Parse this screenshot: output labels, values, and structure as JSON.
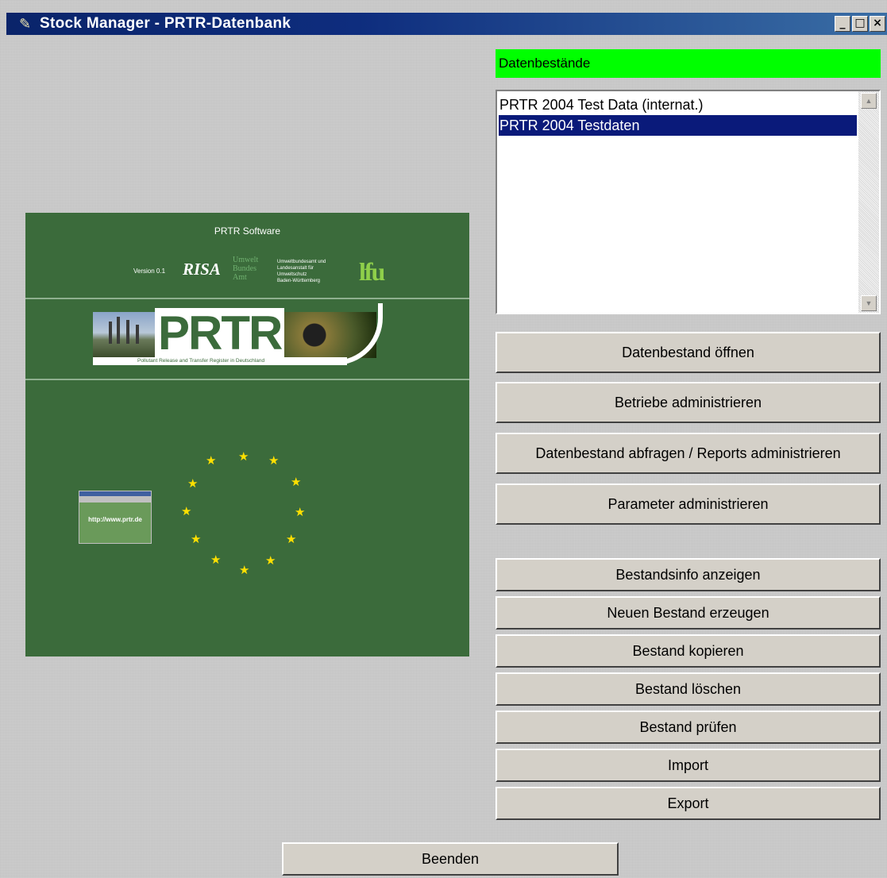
{
  "window": {
    "title": "Stock Manager - PRTR-Datenbank",
    "icon": "feather-icon",
    "controls": {
      "minimize": "_",
      "maximize": "□",
      "close": "×"
    }
  },
  "datasets": {
    "heading": "Datenbestände",
    "heading_color": "#00ff00",
    "items": [
      {
        "label": "PRTR 2004 Test Data (internat.)",
        "selected": false
      },
      {
        "label": "PRTR 2004 Testdaten",
        "selected": true
      }
    ]
  },
  "buttons": {
    "open": "Datenbestand öffnen",
    "facilities": "Betriebe administrieren",
    "query_reports": "Datenbestand abfragen / Reports administrieren",
    "parameters": "Parameter administrieren",
    "info": "Bestandsinfo anzeigen",
    "create": "Neuen Bestand erzeugen",
    "copy": "Bestand kopieren",
    "delete": "Bestand löschen",
    "check": "Bestand prüfen",
    "import": "Import",
    "export": "Export",
    "quit": "Beenden"
  },
  "splash": {
    "title": "PRTR Software",
    "version": "Version 0.1",
    "risa_logo": "RISA",
    "uba_logo": [
      "Umwelt",
      "Bundes",
      "Amt"
    ],
    "partner_text": [
      "Umweltbundesamt und",
      "Landesanstalt für",
      "Umweltschutz",
      "Baden-Württemberg"
    ],
    "lfu_logo": "lfu",
    "banner_word": "PRTR",
    "banner_subtitle": "Pollutant Release and Transfer Register in Deutschland",
    "url": "http://www.prtr.de",
    "background_color": "#3b6b3b"
  }
}
